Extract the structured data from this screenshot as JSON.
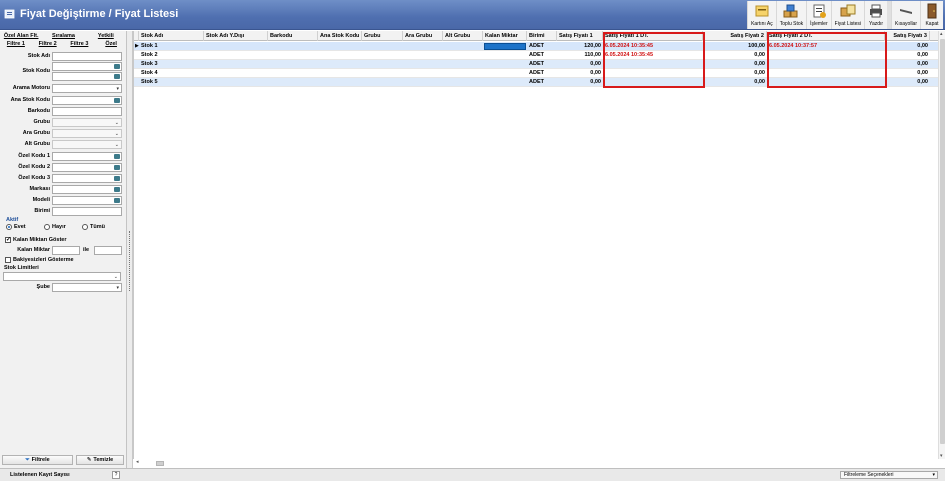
{
  "window": {
    "title": "Fiyat Değiştirme / Fiyat Listesi"
  },
  "toolbar": {
    "buttons": [
      {
        "label": "Kartını Aç",
        "icon": "card-open-icon"
      },
      {
        "label": "Toplu Stok",
        "icon": "bulk-stock-icon"
      },
      {
        "label": "İşlemler",
        "icon": "operations-icon"
      },
      {
        "label": "Fiyat Listesi",
        "icon": "price-list-icon"
      },
      {
        "label": "Yazdır",
        "icon": "printer-icon"
      },
      {
        "label": "Kısayollar",
        "icon": "shortcuts-icon"
      },
      {
        "label": "Kapat",
        "icon": "exit-door-icon"
      }
    ]
  },
  "filter_panel": {
    "tabs_top": [
      "Özel Alan Flt.",
      "Sıralama",
      "Yetkili"
    ],
    "tabs_bottom": [
      "Filtre 1",
      "Filtre 2",
      "Filtre 3",
      "Özel"
    ],
    "fields": {
      "stok_adi": "Stok Adı",
      "stok_kodu": "Stok Kodu",
      "arama_motoru": "Arama Motoru",
      "ana_stok_kodu": "Ana Stok Kodu",
      "barkodu": "Barkodu",
      "grubu": "Grubu",
      "ara_grubu": "Ara Grubu",
      "alt_grubu": "Alt Grubu",
      "ozel_kodu_1": "Özel Kodu 1",
      "ozel_kodu_2": "Özel Kodu 2",
      "ozel_kodu_3": "Özel Kodu 3",
      "markasi": "Markası",
      "modeli": "Modeli",
      "birimi": "Birimi"
    },
    "aktif": {
      "label": "Aktif",
      "options": [
        "Evet",
        "Hayır",
        "Tümü"
      ],
      "selected": "Evet"
    },
    "kalan_miktari_goster": {
      "label": "Kalan Miktarı Göster",
      "checked": true
    },
    "kalan_miktar": {
      "label": "Kalan Miktar",
      "between": "ile"
    },
    "bakiyesizleri_gosterme": {
      "label": "Bakiyesizleri Gösterme",
      "checked": false
    },
    "stok_limitleri": "Stok Limitleri",
    "sube": "Şube",
    "filter_button": "Filtrele",
    "clear_button": "Temizle"
  },
  "grid": {
    "columns": [
      "Stok Adı",
      "Stok Adı Y.Dışı",
      "Barkodu",
      "Ana Stok Kodu",
      "Grubu",
      "Ara Grubu",
      "Alt Grubu",
      "Kalan Miktar",
      "Birimi",
      "Satış Fiyatı 1",
      "Satış Fiyatı 1 DT.",
      "Satış Fiyatı 2",
      "Satış Fiyatı 2 DT.",
      "Satış Fiyatı 3"
    ],
    "rows": [
      {
        "stok_adi": "Stok 1",
        "birimi": "ADET",
        "sf1": "120,00",
        "sf1_dt": "6.05.2024 10:35:45",
        "sf2": "100,00",
        "sf2_dt": "6.05.2024 10:37:57",
        "sf3": "0,00"
      },
      {
        "stok_adi": "Stok 2",
        "birimi": "ADET",
        "sf1": "110,00",
        "sf1_dt": "6.05.2024 10:35:45",
        "sf2": "0,00",
        "sf2_dt": "",
        "sf3": "0,00"
      },
      {
        "stok_adi": "Stok 3",
        "birimi": "ADET",
        "sf1": "0,00",
        "sf1_dt": "",
        "sf2": "0,00",
        "sf2_dt": "",
        "sf3": "0,00"
      },
      {
        "stok_adi": "Stok 4",
        "birimi": "ADET",
        "sf1": "0,00",
        "sf1_dt": "",
        "sf2": "0,00",
        "sf2_dt": "",
        "sf3": "0,00"
      },
      {
        "stok_adi": "Stok 5",
        "birimi": "ADET",
        "sf1": "0,00",
        "sf1_dt": "",
        "sf2": "0,00",
        "sf2_dt": "",
        "sf3": "0,00"
      }
    ]
  },
  "statusbar": {
    "count_label": "Listelenen Kayıt Sayısı",
    "help": "?",
    "filter_options": "Filtreleme Seçenekleri"
  },
  "colors": {
    "title_bar": "#5677b8",
    "highlight_box": "#d81a1a",
    "date_text": "#d01010",
    "alt_row": "#ddeafa"
  }
}
